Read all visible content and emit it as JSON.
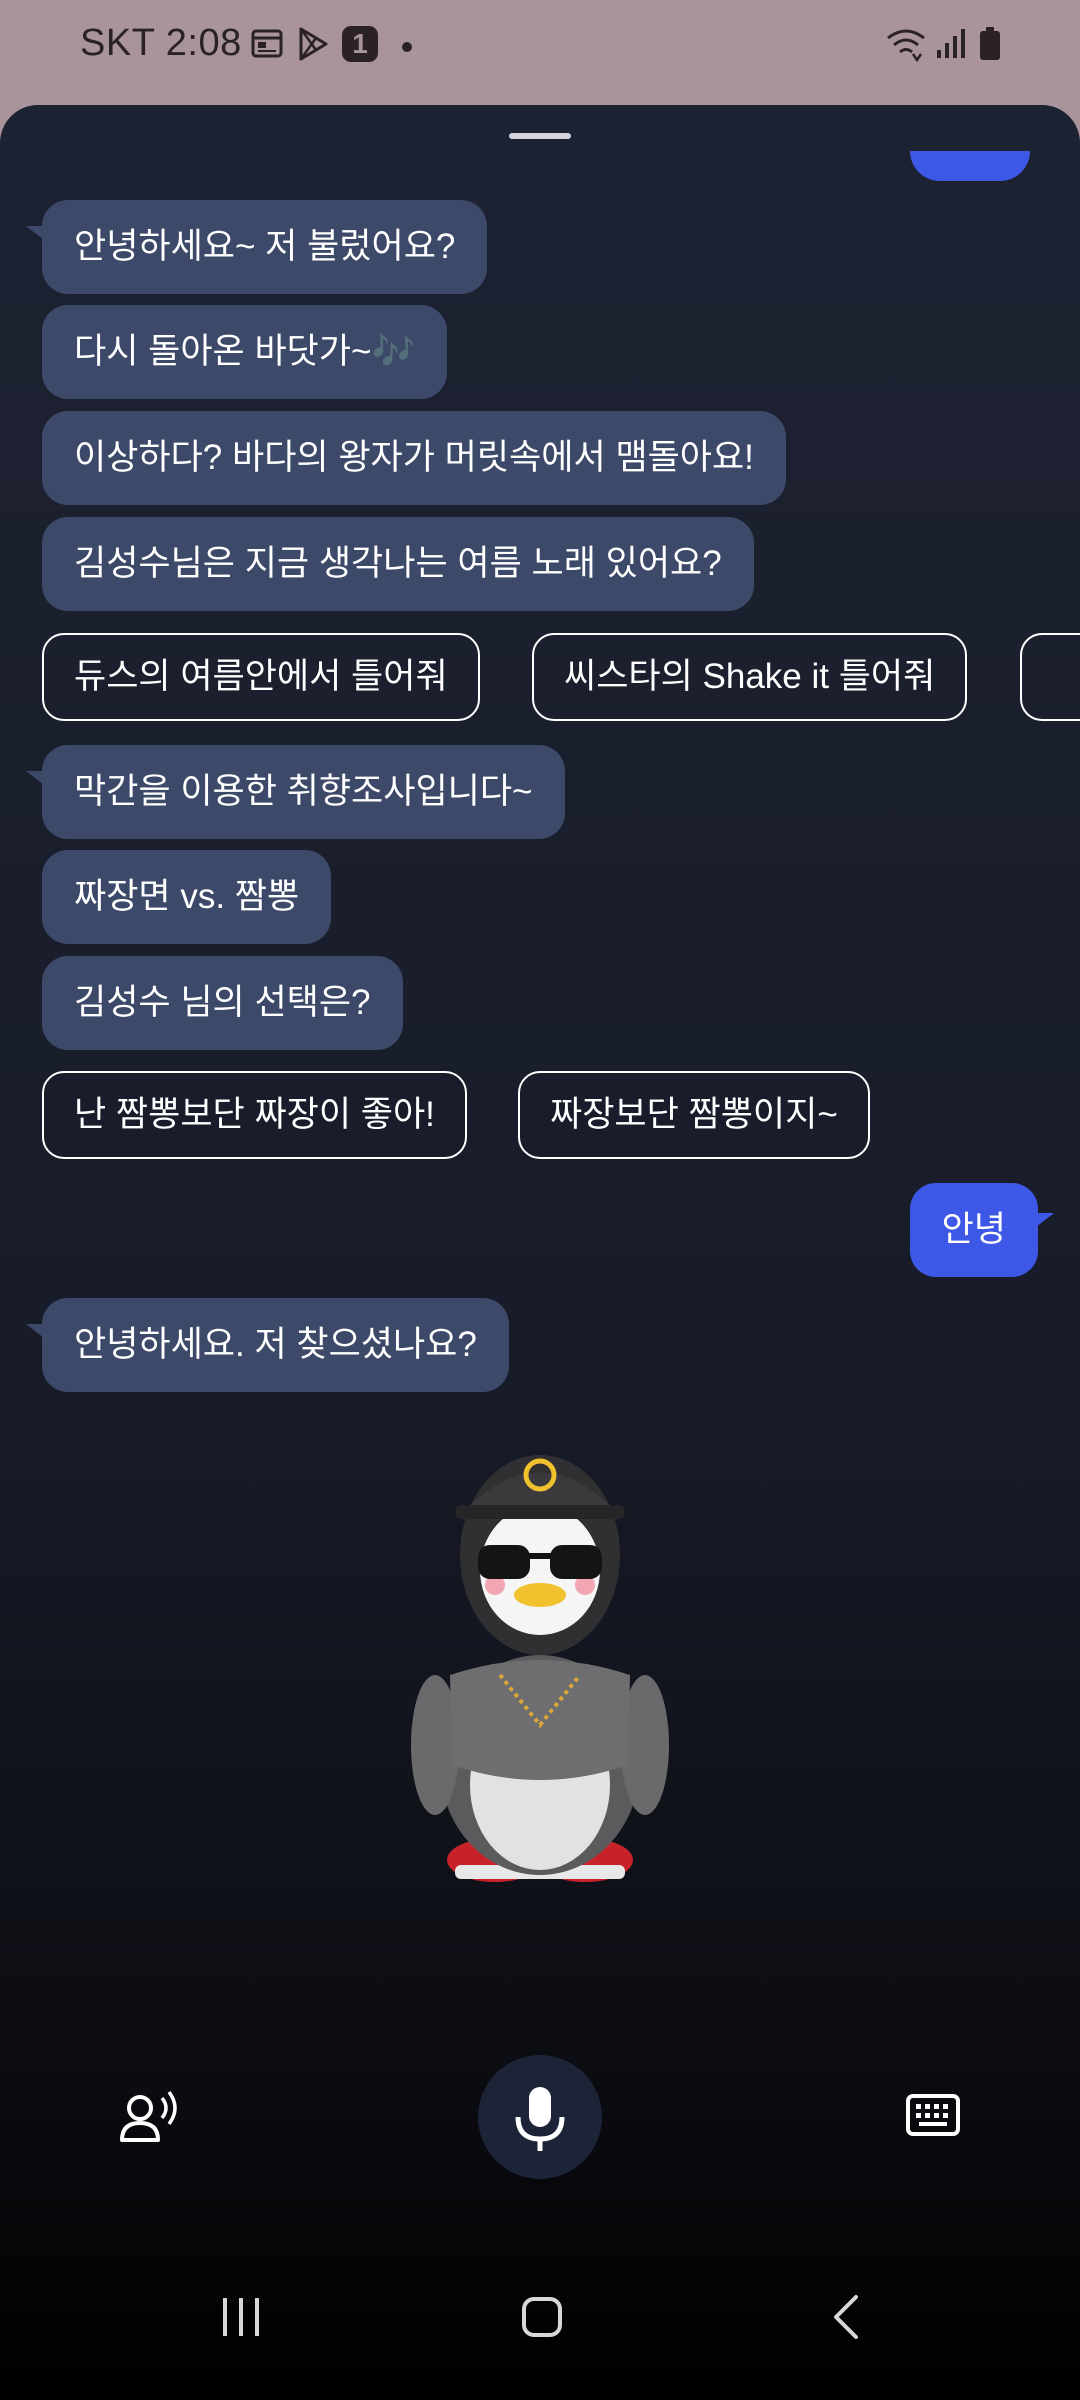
{
  "status_bar": {
    "time": "SKT 2:08",
    "left_icons": [
      "calendar-icon",
      "play-store-icon",
      "badge-1-icon"
    ],
    "badge_text": "1",
    "right_icons": [
      "wifi-icon",
      "signal-icon",
      "battery-icon"
    ]
  },
  "colors": {
    "bot_bubble": "#3d4968",
    "user_bubble": "#3d58e6",
    "sheet_bg": "#1d2232",
    "status_bg": "#a8949a"
  },
  "chat": {
    "bot_group_1": [
      "안녕하세요~ 저 불렀어요?",
      "다시 돌아온 바닷가~🎶",
      "이상하다? 바다의 왕자가 머릿속에서 맴돌아요!",
      "김성수님은 지금 생각나는 여름 노래 있어요?"
    ],
    "chips_1": [
      "듀스의 여름안에서 틀어줘",
      "씨스타의 Shake it 틀어줘"
    ],
    "bot_group_2": [
      "막간을 이용한 취향조사입니다~",
      "짜장면 vs. 짬뽕",
      "김성수 님의 선택은?"
    ],
    "chips_2": [
      "난 짬뽕보단 짜장이 좋아!",
      "짜장보단 짬뽕이지~"
    ],
    "user_message": "안녕",
    "bot_reply": "안녕하세요. 저 찾으셨나요?"
  },
  "bottom_bar": {
    "left": "voice-settings-icon",
    "center": "microphone-icon",
    "right": "keyboard-icon"
  },
  "nav_bar": [
    "recent-apps-icon",
    "home-icon",
    "back-icon"
  ]
}
